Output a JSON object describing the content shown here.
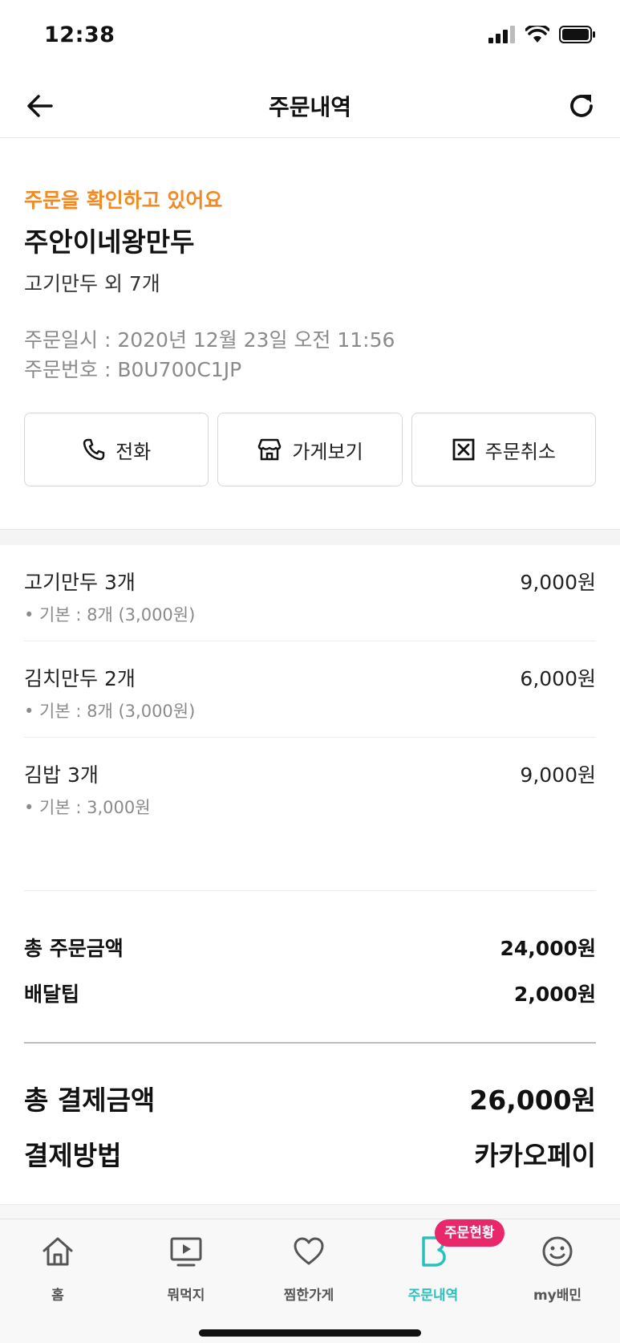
{
  "status_bar": {
    "time": "12:38",
    "icons": [
      "signal-icon",
      "wifi-icon",
      "battery-icon"
    ]
  },
  "nav": {
    "title": "주문내역",
    "back_icon": "arrow-left-icon",
    "refresh_icon": "refresh-icon"
  },
  "order": {
    "status": "주문을 확인하고 있어요",
    "store_name": "주안이네왕만두",
    "summary": "고기만두 외 7개",
    "date": "주문일시 : 2020년 12월 23일 오전 11:56",
    "number": "주문번호 : B0U700C1JP",
    "status_color": "#f08a24"
  },
  "actions": [
    {
      "label": "전화",
      "icon": "phone-icon"
    },
    {
      "label": "가게보기",
      "icon": "store-icon"
    },
    {
      "label": "주문취소",
      "icon": "cancel-box-icon"
    }
  ],
  "items": [
    {
      "name": "고기만두 3개",
      "price": "9,000원",
      "option": "• 기본 : 8개 (3,000원)"
    },
    {
      "name": "김치만두 2개",
      "price": "6,000원",
      "option": "• 기본 : 8개 (3,000원)"
    },
    {
      "name": "김밥 3개",
      "price": "9,000원",
      "option": "• 기본 : 3,000원"
    }
  ],
  "summary": {
    "order_total_label": "총 주문금액",
    "order_total_value": "24,000원",
    "delivery_tip_label": "배달팁",
    "delivery_tip_value": "2,000원"
  },
  "payment": {
    "total_label": "총 결제금액",
    "total_value": "26,000원",
    "method_label": "결제방법",
    "method_value": "카카오페이"
  },
  "tabs": [
    {
      "label": "홈",
      "icon": "home-icon"
    },
    {
      "label": "뭐먹지",
      "icon": "play-screen-icon"
    },
    {
      "label": "찜한가게",
      "icon": "heart-icon"
    },
    {
      "label": "주문내역",
      "icon": "order-b-icon",
      "active": true
    },
    {
      "label": "my배민",
      "icon": "smile-icon"
    }
  ],
  "tab_badge": "주문현황",
  "colors": {
    "accent": "#2ac1bc",
    "badge": "#e8286b",
    "status": "#f08a24"
  }
}
